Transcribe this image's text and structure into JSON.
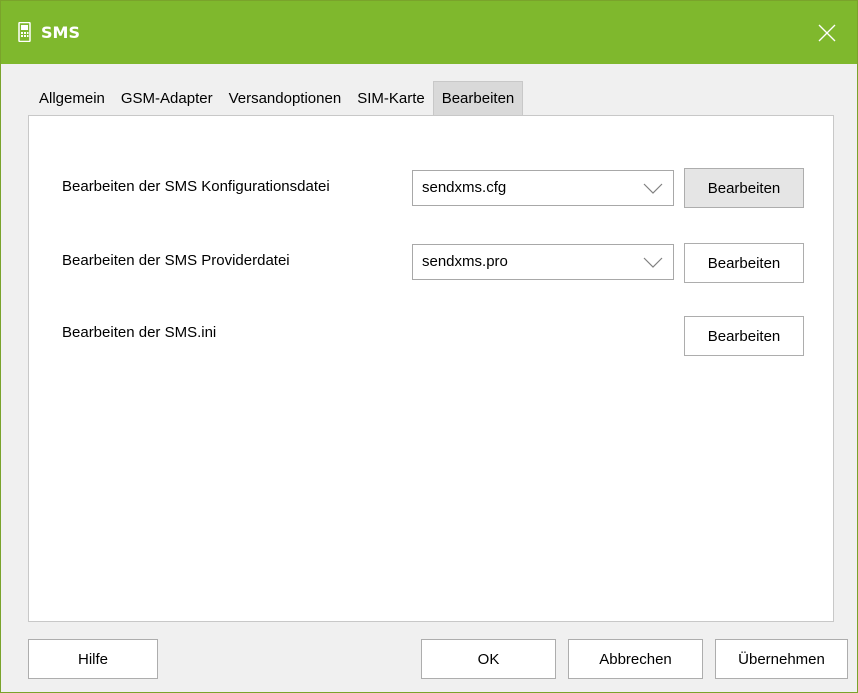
{
  "window": {
    "title": "SMS",
    "accent_color": "#7fb82d",
    "icon": "phone-icon",
    "close_icon": "close-icon"
  },
  "tabs": [
    {
      "label": "Allgemein",
      "active": false
    },
    {
      "label": "GSM-Adapter",
      "active": false
    },
    {
      "label": "Versandoptionen",
      "active": false
    },
    {
      "label": "SIM-Karte",
      "active": false
    },
    {
      "label": "Bearbeiten",
      "active": true
    }
  ],
  "rows": [
    {
      "label": "Bearbeiten der SMS Konfigurationsdatei",
      "combo_value": "sendxms.cfg",
      "button": "Bearbeiten"
    },
    {
      "label": "Bearbeiten der SMS Providerdatei",
      "combo_value": "sendxms.pro",
      "button": "Bearbeiten"
    },
    {
      "label": "Bearbeiten der SMS.ini",
      "button": "Bearbeiten"
    }
  ],
  "footer": {
    "help": "Hilfe",
    "ok": "OK",
    "cancel": "Abbrechen",
    "apply": "Übernehmen"
  }
}
